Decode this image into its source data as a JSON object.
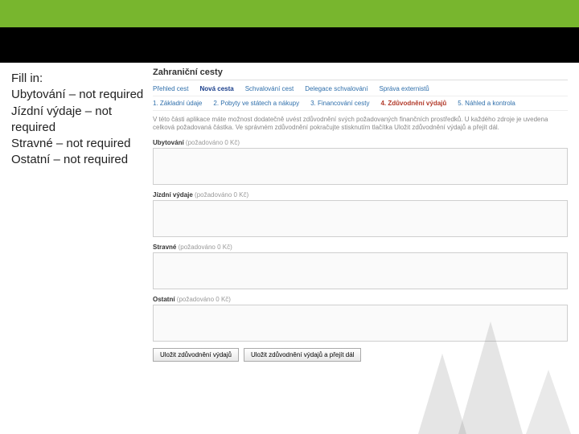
{
  "instructions": {
    "heading": "Fill in:",
    "lines": [
      "Ubytování – not required",
      "Jízdní výdaje – not required",
      "Stravné – not required",
      "Ostatní – not required"
    ]
  },
  "panel": {
    "title": "Zahraniční cesty",
    "tabs": [
      {
        "label": "Přehled cest",
        "active": false
      },
      {
        "label": "Nová cesta",
        "active": true
      },
      {
        "label": "Schvalování cest",
        "active": false
      },
      {
        "label": "Delegace schvalování",
        "active": false
      },
      {
        "label": "Správa externistů",
        "active": false
      }
    ],
    "steps": [
      {
        "label": "1. Základní údaje",
        "active": false
      },
      {
        "label": "2. Pobyty ve státech a nákupy",
        "active": false
      },
      {
        "label": "3. Financování cesty",
        "active": false
      },
      {
        "label": "4. Zdůvodnění výdajů",
        "active": true
      },
      {
        "label": "5. Náhled a kontrola",
        "active": false
      }
    ],
    "helptext": "V této části aplikace máte možnost dodatečně uvést zdůvodnění svých požadovaných finančních prostředků. U každého zdroje je uvedena celková požadovaná částka. Ve správném zdůvodnění pokračujte stisknutím tlačítka Uložit zdůvodnění výdajů a přejít dál.",
    "fields": [
      {
        "name": "Ubytování",
        "muted": "(požadováno 0 Kč)",
        "value": ""
      },
      {
        "name": "Jízdní výdaje",
        "muted": "(požadováno 0 Kč)",
        "value": ""
      },
      {
        "name": "Stravné",
        "muted": "(požadováno 0 Kč)",
        "value": ""
      },
      {
        "name": "Ostatní",
        "muted": "(požadováno 0 Kč)",
        "value": ""
      }
    ],
    "buttons": {
      "save": "Uložit zdůvodnění výdajů",
      "save_next": "Uložit zdůvodnění výdajů a přejít dál"
    }
  }
}
